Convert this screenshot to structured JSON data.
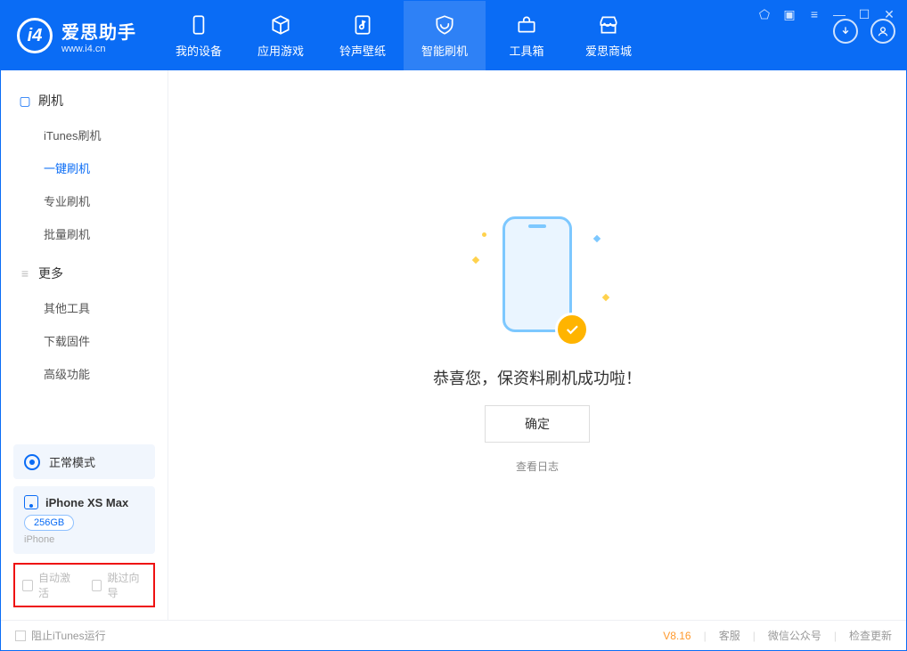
{
  "app": {
    "name_ch": "爱思助手",
    "name_en": "www.i4.cn"
  },
  "nav": {
    "items": [
      {
        "label": "我的设备"
      },
      {
        "label": "应用游戏"
      },
      {
        "label": "铃声壁纸"
      },
      {
        "label": "智能刷机"
      },
      {
        "label": "工具箱"
      },
      {
        "label": "爱思商城"
      }
    ]
  },
  "sidebar": {
    "sections": [
      {
        "title": "刷机",
        "items": [
          "iTunes刷机",
          "一键刷机",
          "专业刷机",
          "批量刷机"
        ]
      },
      {
        "title": "更多",
        "items": [
          "其他工具",
          "下载固件",
          "高级功能"
        ]
      }
    ],
    "mode_label": "正常模式",
    "device": {
      "name": "iPhone XS Max",
      "capacity": "256GB",
      "type": "iPhone"
    },
    "options": {
      "auto_activate": "自动激活",
      "skip_guide": "跳过向导"
    }
  },
  "content": {
    "success_msg": "恭喜您，保资料刷机成功啦！",
    "confirm_label": "确定",
    "view_log_label": "查看日志"
  },
  "footer": {
    "block_itunes": "阻止iTunes运行",
    "version": "V8.16",
    "links": [
      "客服",
      "微信公众号",
      "检查更新"
    ]
  }
}
